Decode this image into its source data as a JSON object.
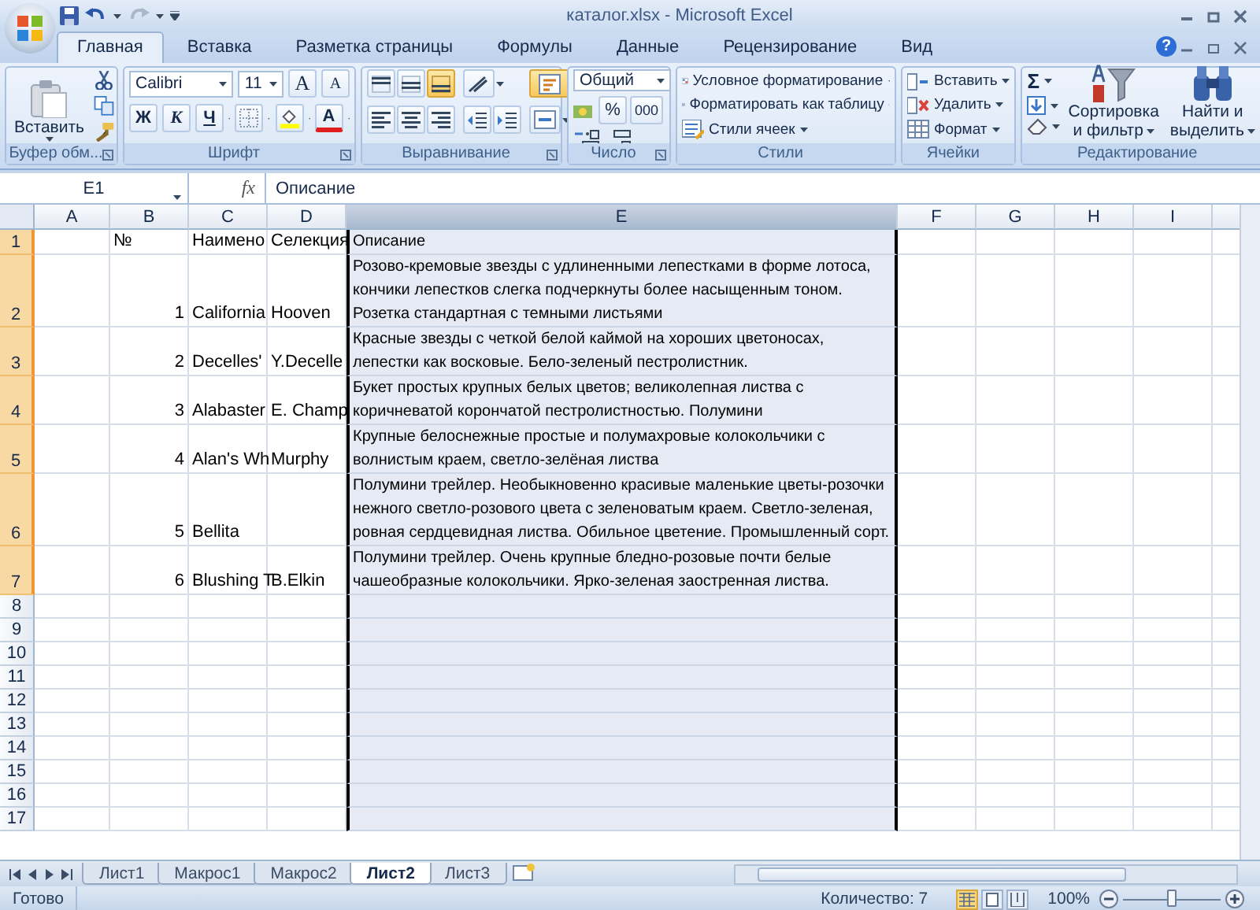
{
  "title_bar": {
    "title": "каталог.xlsx - Microsoft Excel"
  },
  "ribbon_tabs": [
    {
      "label": "Главная",
      "selected": true
    },
    {
      "label": "Вставка",
      "selected": false
    },
    {
      "label": "Разметка страницы",
      "selected": false
    },
    {
      "label": "Формулы",
      "selected": false
    },
    {
      "label": "Данные",
      "selected": false
    },
    {
      "label": "Рецензирование",
      "selected": false
    },
    {
      "label": "Вид",
      "selected": false
    }
  ],
  "help": "?",
  "clipboard": {
    "paste": "Вставить",
    "label": "Буфер обм..."
  },
  "font": {
    "name": "Calibri",
    "size": "11",
    "grow": "A",
    "shrink": "A",
    "bold": "Ж",
    "italic": "К",
    "underline": "Ч",
    "font_color_button": "A",
    "label": "Шрифт"
  },
  "alignment": {
    "label": "Выравнивание"
  },
  "number": {
    "format": "Общий",
    "percent": "%",
    "thousands": "000",
    "label": "Число"
  },
  "styles": {
    "items": [
      "Условное форматирование",
      "Форматировать как таблицу",
      "Стили ячеек"
    ],
    "label": "Стили"
  },
  "cells": {
    "items": [
      "Вставить",
      "Удалить",
      "Формат"
    ],
    "label": "Ячейки"
  },
  "editing": {
    "sum": "Σ",
    "sort": [
      "Сортировка",
      "и фильтр"
    ],
    "find": [
      "Найти и",
      "выделить"
    ],
    "label": "Редактирование"
  },
  "formula_bar": {
    "name_box": "E1",
    "fx": "fx",
    "formula": "Описание"
  },
  "sheet": {
    "columns": [
      {
        "label": "A",
        "selected": false
      },
      {
        "label": "B",
        "selected": false
      },
      {
        "label": "C",
        "selected": false
      },
      {
        "label": "D",
        "selected": false
      },
      {
        "label": "E",
        "selected": true
      },
      {
        "label": "F",
        "selected": false
      },
      {
        "label": "G",
        "selected": false
      },
      {
        "label": "H",
        "selected": false
      },
      {
        "label": "I",
        "selected": false
      }
    ],
    "rows": [
      {
        "header": "1",
        "selected": true,
        "cells": {
          "B": "№",
          "C": "Наимено",
          "D": "Селекция",
          "E": "Описание"
        }
      },
      {
        "header": "2",
        "selected": true,
        "cells": {
          "B": "1",
          "C": "California",
          "D": "Hooven",
          "E": "Розово-кремовые звезды с удлиненными лепестками в форме лотоса, кончики лепестков слегка подчеркнуты более насыщенным тоном. Розетка стандартная с темными листьями"
        }
      },
      {
        "header": "3",
        "selected": true,
        "cells": {
          "B": "2",
          "C": "Decelles'",
          "D": "Y.Decelle",
          "E": "Красные звезды с четкой белой каймой на хороших цветоносах, лепестки как восковые. Бело-зеленый пестролистник."
        }
      },
      {
        "header": "4",
        "selected": true,
        "cells": {
          "B": "3",
          "C": "Alabaster",
          "D": "E. Champ",
          "E": "Букет простых крупных белых цветов; великолепная листва с коричневатой корончатой пестролистностью. Полумини"
        }
      },
      {
        "header": "5",
        "selected": true,
        "cells": {
          "B": "4",
          "C": "Alan's Wh",
          "D": "Murphy",
          "E": "Крупные белоснежные простые и полумахровые колокольчики с волнистым краем, светло-зелёная листва"
        }
      },
      {
        "header": "6",
        "selected": true,
        "cells": {
          "B": "5",
          "C": "Bellita",
          "E": "Полумини трейлер. Необыкновенно красивые маленькие цветы-розочки нежного светло-розового цвета с зеленоватым краем. Светло-зеленая, ровная сердцевидная листва. Обильное цветение. Промышленный сорт."
        }
      },
      {
        "header": "7",
        "selected": true,
        "cells": {
          "B": "6",
          "C": "Blushing T",
          "D": "B.Elkin",
          "E": "Полумини трейлер. Очень крупные бледно-розовые почти белые чашеобразные колокольчики. Ярко-зеленая заостренная листва."
        }
      },
      {
        "header": "8",
        "selected": false
      },
      {
        "header": "9",
        "selected": false
      },
      {
        "header": "10",
        "selected": false
      },
      {
        "header": "11",
        "selected": false
      },
      {
        "header": "12",
        "selected": false
      },
      {
        "header": "13",
        "selected": false
      },
      {
        "header": "14",
        "selected": false
      },
      {
        "header": "15",
        "selected": false
      },
      {
        "header": "16",
        "selected": false
      },
      {
        "header": "17",
        "selected": false
      }
    ]
  },
  "sheet_tabs": [
    {
      "label": "Лист1",
      "selected": false
    },
    {
      "label": "Макрос1",
      "selected": false
    },
    {
      "label": "Макрос2",
      "selected": false
    },
    {
      "label": "Лист2",
      "selected": true
    },
    {
      "label": "Лист3",
      "selected": false
    }
  ],
  "status_bar": {
    "ready": "Готово",
    "count": "Количество: 7",
    "views": [
      {
        "kind": "normal",
        "selected": true
      },
      {
        "kind": "layout",
        "selected": false
      },
      {
        "kind": "page-break",
        "selected": false
      }
    ],
    "zoom": "100%",
    "zoom_slider": {
      "level": 0.5
    }
  }
}
